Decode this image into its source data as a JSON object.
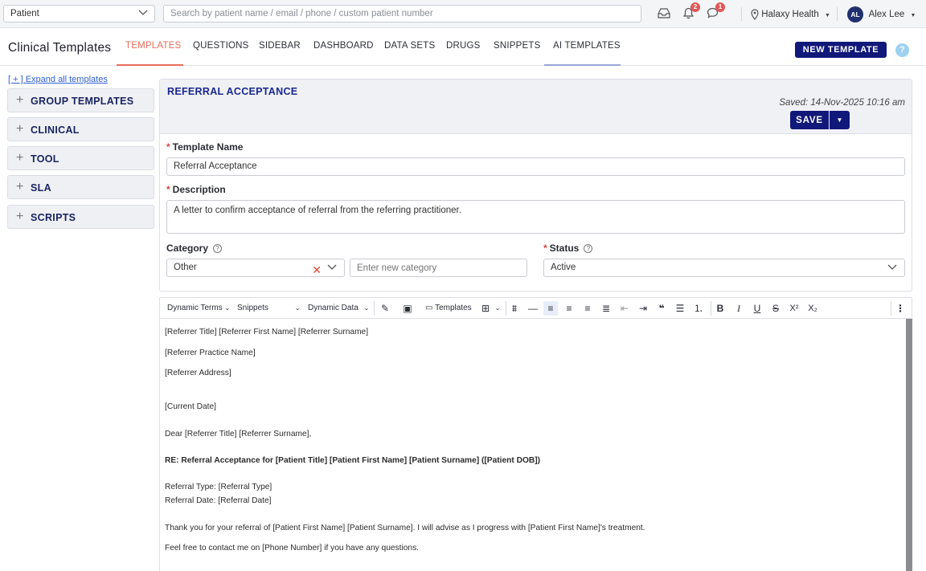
{
  "topbar": {
    "patient_type": "Patient",
    "search_placeholder": "Search by patient name / email / phone / custom patient number",
    "notifications_count": "2",
    "messages_count": "1",
    "org_name": "Halaxy Health",
    "user_initials": "AL",
    "user_name": "Alex Lee"
  },
  "nav": {
    "title": "Clinical Templates",
    "tabs": [
      "TEMPLATES",
      "QUESTIONS",
      "SIDEBAR",
      "DASHBOARD",
      "DATA SETS",
      "DRUGS",
      "SNIPPETS",
      "AI TEMPLATES"
    ],
    "active_tab": "TEMPLATES",
    "new_template_label": "NEW TEMPLATE",
    "help_label": "?",
    "colors": {
      "active_tab": "#e86c5a",
      "ai_underline": "#9aa6d8",
      "primary": "#10187a"
    }
  },
  "sidebar": {
    "expand_link": "[ + ] Expand all templates",
    "groups": [
      "GROUP TEMPLATES",
      "CLINICAL",
      "TOOL",
      "SLA",
      "SCRIPTS"
    ]
  },
  "template": {
    "title": "REFERRAL ACCEPTANCE",
    "saved_text": "Saved: 14-Nov-2025 10:16 am",
    "save_label": "SAVE",
    "name_label": "Template Name",
    "name_value": "Referral Acceptance",
    "description_label": "Description",
    "description_value": "A letter to confirm acceptance of referral from the referring practitioner.",
    "category_label": "Category",
    "category_value": "Other",
    "new_category_placeholder": "Enter new category",
    "status_label": "Status",
    "status_value": "Active"
  },
  "toolbar": {
    "dynamic_terms": "Dynamic Terms",
    "snippets": "Snippets",
    "dynamic_data": "Dynamic Data",
    "templates": "Templates"
  },
  "editor": {
    "lines": [
      "[Referrer Title] [Referrer First Name] [Referrer Surname]",
      "[Referrer Practice Name]",
      "[Referrer Address]",
      "[Current Date]",
      "Dear [Referrer Title] [Referrer Surname],",
      "RE: Referral Acceptance for [Patient Title] [Patient First Name] [Patient Surname] ([Patient DOB])",
      "Referral Type: [Referral Type]",
      "Referral Date: [Referral Date]",
      "Thank you for your referral of [Patient First Name] [Patient Surname]. I will advise as I progress with [Patient First Name]'s treatment.",
      "Feel free to contact me on [Phone Number] if you have any questions."
    ]
  }
}
